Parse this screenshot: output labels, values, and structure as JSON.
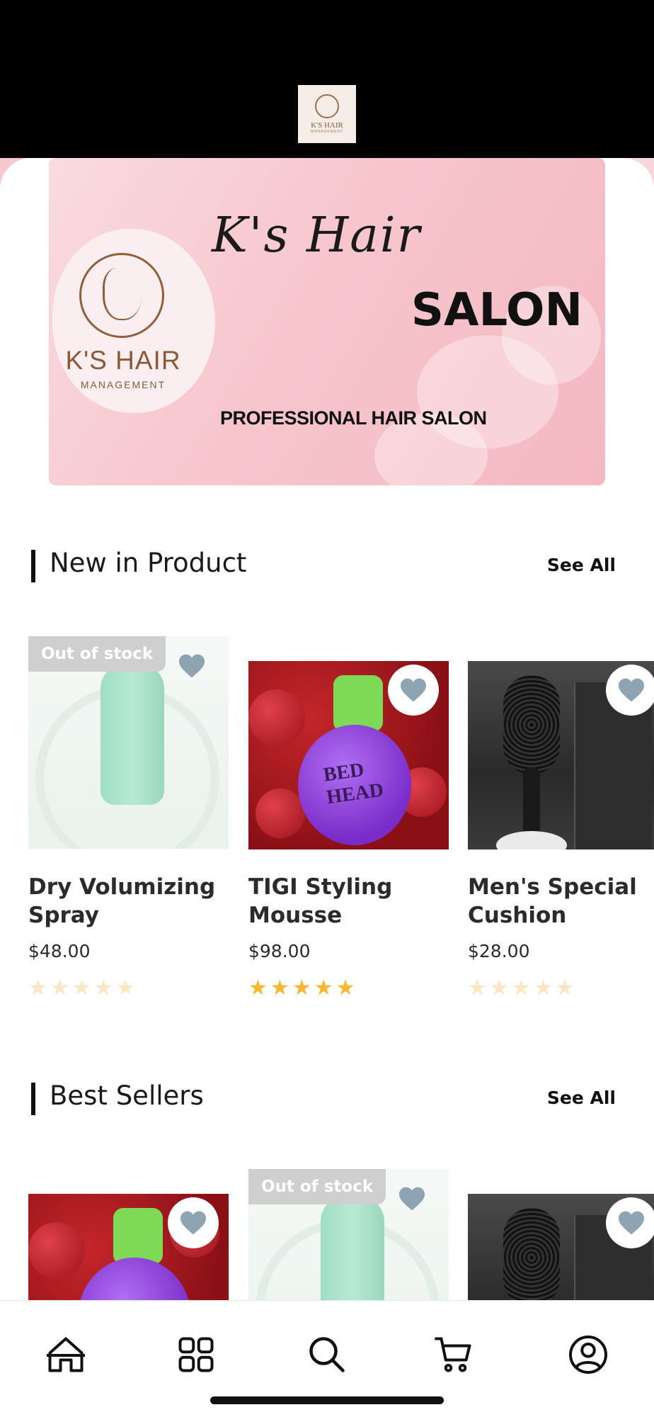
{
  "header": {
    "logo_name": "K'S HAIR",
    "logo_sub": "MANAGEMENT"
  },
  "banner": {
    "script_title": "K's Hair",
    "salon_word": "SALON",
    "tagline": "PROFESSIONAL HAIR SALON",
    "badge_name": "K'S HAIR",
    "badge_sub": "MANAGEMENT"
  },
  "sections": {
    "new_in": {
      "title": "New in Product",
      "see_all": "See All"
    },
    "best_sellers": {
      "title": "Best Sellers",
      "see_all": "See All"
    }
  },
  "new_products": [
    {
      "name": "Dry Volumizing Spray",
      "price": "$48.00",
      "rating": 0,
      "out_of_stock": "Out of stock",
      "art": "spray"
    },
    {
      "name": "TIGI Styling Mousse",
      "price": "$98.00",
      "rating": 5,
      "out_of_stock": "",
      "art": "mousse"
    },
    {
      "name": "Men's Special Cushion",
      "price": "$28.00",
      "rating": 0,
      "out_of_stock": "",
      "art": "brush"
    }
  ],
  "best_sellers": [
    {
      "out_of_stock": "",
      "art": "mousse"
    },
    {
      "out_of_stock": "Out of stock",
      "art": "spray"
    },
    {
      "out_of_stock": "",
      "art": "brush"
    }
  ],
  "nav": [
    "home-icon",
    "categories-icon",
    "search-icon",
    "cart-icon",
    "profile-icon"
  ],
  "colors": {
    "star": "#f7b733",
    "star_dim": "#fbe6c3",
    "heart": "#8fa4b3",
    "banner_pink": "#f7c6cd"
  }
}
